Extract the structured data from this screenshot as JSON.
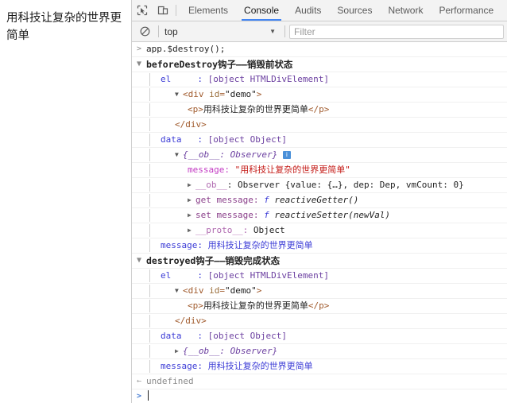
{
  "page": {
    "rendered_text": "用科技让复杂的世界更简单"
  },
  "toolbar": {
    "inspect_icon": "inspect-cursor-icon",
    "device_icon": "device-toolbar-icon",
    "tabs": [
      {
        "label": "Elements",
        "active": false
      },
      {
        "label": "Console",
        "active": true
      },
      {
        "label": "Audits",
        "active": false
      },
      {
        "label": "Sources",
        "active": false
      },
      {
        "label": "Network",
        "active": false
      },
      {
        "label": "Performance",
        "active": false
      }
    ],
    "active_tab": "Console",
    "accent_color": "#4285f4"
  },
  "filterbar": {
    "clear_icon": "clear-console-icon",
    "context": "top",
    "caret": "▼",
    "filter_placeholder": "Filter"
  },
  "console": {
    "command": "app.$destroy();",
    "command_gutter": ">",
    "result_gutter": "←",
    "result": "undefined",
    "prompt_gutter": ">",
    "group1": {
      "tri": "▼",
      "title": "beforeDestroy钩子——销毁前状态",
      "title_bold": "beforeDestroy",
      "el_key": "el",
      "el_sep": ":",
      "el_val": "[object HTMLDivElement]",
      "dom": {
        "tri": "▼",
        "open_tag": "<div",
        "attr_name": "id",
        "attr_eq": "=",
        "attr_val": "\"demo\"",
        "open_close": ">",
        "child_open": "<p>",
        "child_text": "用科技让复杂的世界更简单",
        "child_close": "</p>",
        "close_tag": "</div>"
      },
      "data_key": "data",
      "data_sep": ":",
      "data_val": "[object Object]",
      "observer": {
        "tri": "▼",
        "label": "{__ob__: Observer}",
        "info_icon": "info-icon",
        "info_glyph": "i",
        "message_key": "message:",
        "message_val": "\"用科技让复杂的世界更简单\"",
        "ob_tri": "▶",
        "ob_key": "__ob__",
        "ob_sep": ": ",
        "ob_val": "Observer {value: {…}, dep: Dep, vmCount: 0}",
        "get_tri": "▶",
        "get_key": "get message:",
        "get_fn_kw": "f",
        "get_fn": "reactiveGetter()",
        "set_tri": "▶",
        "set_key": "set message:",
        "set_fn_kw": "f",
        "set_fn": "reactiveSetter(newVal)",
        "proto_tri": "▶",
        "proto_key": "__proto__:",
        "proto_val": "Object"
      },
      "message_key": "message:",
      "message_val": "用科技让复杂的世界更简单"
    },
    "group2": {
      "tri": "▼",
      "title": "destroyed钩子——销毁完成状态",
      "title_bold": "destroyed",
      "el_key": "el",
      "el_sep": ":",
      "el_val": "[object HTMLDivElement]",
      "dom": {
        "tri": "▼",
        "open_tag": "<div",
        "attr_name": "id",
        "attr_eq": "=",
        "attr_val": "\"demo\"",
        "open_close": ">",
        "child_open": "<p>",
        "child_text": "用科技让复杂的世界更简单",
        "child_close": "</p>",
        "close_tag": "</div>"
      },
      "data_key": "data",
      "data_sep": ":",
      "data_val": "[object Object]",
      "observer_tri": "▶",
      "observer_label": "{__ob__: Observer}",
      "message_key": "message:",
      "message_val": "用科技让复杂的世界更简单"
    }
  }
}
